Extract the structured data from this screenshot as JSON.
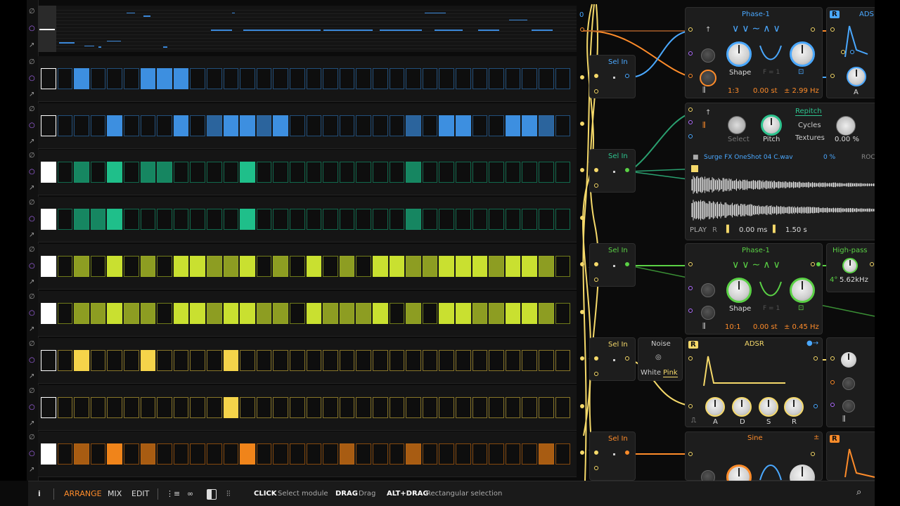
{
  "piano_roll": {
    "value": "0"
  },
  "grid": {
    "rows": [
      {
        "color": "#3d8fe0",
        "cells": [
          3,
          0,
          2,
          0,
          0,
          0,
          2,
          3,
          2,
          0,
          0,
          0,
          0,
          0,
          0,
          0,
          0,
          0,
          0,
          0,
          0,
          0,
          0,
          0,
          0,
          0,
          0,
          0,
          0,
          0,
          0,
          0
        ]
      },
      {
        "color": "#3d8fe0",
        "cells": [
          3,
          0,
          0,
          0,
          2,
          0,
          0,
          0,
          2,
          0,
          1,
          2,
          2,
          1,
          2,
          0,
          0,
          0,
          0,
          0,
          0,
          0,
          1,
          0,
          2,
          2,
          0,
          0,
          2,
          2,
          1,
          0
        ]
      },
      {
        "color": "#1fbf8a",
        "cells": [
          3,
          0,
          1,
          0,
          2,
          0,
          1,
          1,
          0,
          0,
          0,
          0,
          2,
          0,
          0,
          0,
          0,
          0,
          0,
          0,
          0,
          0,
          1,
          0,
          0,
          0,
          0,
          0,
          0,
          0,
          0,
          0
        ]
      },
      {
        "color": "#1fbf8a",
        "cells": [
          3,
          0,
          1,
          1,
          2,
          0,
          0,
          0,
          0,
          0,
          0,
          0,
          2,
          0,
          0,
          0,
          0,
          0,
          0,
          0,
          0,
          0,
          1,
          0,
          0,
          0,
          0,
          0,
          0,
          0,
          0,
          0
        ]
      },
      {
        "color": "#c9e030",
        "cells": [
          3,
          0,
          1,
          0,
          2,
          0,
          1,
          0,
          2,
          2,
          1,
          1,
          2,
          0,
          1,
          0,
          2,
          0,
          1,
          0,
          2,
          2,
          1,
          1,
          2,
          2,
          2,
          1,
          2,
          2,
          1,
          0
        ]
      },
      {
        "color": "#c9e030",
        "cells": [
          3,
          0,
          1,
          1,
          2,
          1,
          1,
          0,
          2,
          2,
          1,
          2,
          2,
          1,
          1,
          0,
          2,
          1,
          1,
          1,
          2,
          0,
          1,
          0,
          2,
          2,
          1,
          1,
          2,
          2,
          1,
          0
        ]
      },
      {
        "color": "#f5d44a",
        "cells": [
          3,
          0,
          2,
          0,
          0,
          0,
          2,
          0,
          0,
          0,
          0,
          2,
          0,
          0,
          0,
          0,
          0,
          0,
          0,
          0,
          0,
          0,
          0,
          0,
          0,
          0,
          0,
          0,
          0,
          0,
          0,
          0
        ]
      },
      {
        "color": "#f5d44a",
        "cells": [
          3,
          0,
          0,
          0,
          0,
          0,
          0,
          0,
          0,
          0,
          0,
          2,
          0,
          0,
          0,
          0,
          0,
          0,
          0,
          0,
          0,
          0,
          0,
          0,
          0,
          0,
          0,
          0,
          0,
          0,
          0,
          0
        ]
      },
      {
        "color": "#f0841a",
        "cells": [
          3,
          0,
          1,
          0,
          2,
          0,
          1,
          0,
          0,
          0,
          0,
          0,
          2,
          0,
          0,
          0,
          0,
          0,
          1,
          0,
          0,
          0,
          1,
          0,
          0,
          0,
          0,
          0,
          0,
          0,
          1,
          0
        ]
      }
    ]
  },
  "selin": {
    "label": "Sel In"
  },
  "phase1_top": {
    "title": "Phase-1",
    "shape_label": "Shape",
    "f_label": "F = 1",
    "ratio": "1:3",
    "st": "0.00 st",
    "hz": "± 2.99 Hz"
  },
  "adsr_top": {
    "badge": "R",
    "title": "ADS",
    "a_label": "A"
  },
  "sampler": {
    "repitch": "Repitch",
    "cycles": "Cycles",
    "textures": "Textures",
    "select": "Select",
    "pitch": "Pitch",
    "percent": "0.00 %",
    "file": "Surge FX OneShot 04 C.wav",
    "zero_percent": "0 %",
    "roo": "ROC",
    "play": "PLAY",
    "r_mark": "R",
    "start": "0.00 ms",
    "length": "1.50 s"
  },
  "phase1_mid": {
    "title": "Phase-1",
    "shape_label": "Shape",
    "f_label": "F = 1",
    "ratio": "10:1",
    "st": "0.00 st",
    "hz": "± 0.45 Hz"
  },
  "highpass": {
    "title": "High-pass",
    "deg": "4°",
    "freq": "5.62kHz"
  },
  "noise": {
    "title": "Noise",
    "white": "White",
    "pink": "Pink"
  },
  "adsr_mid": {
    "badge": "R",
    "title": "ADSR",
    "a": "A",
    "d": "D",
    "s": "S",
    "r": "R"
  },
  "sine": {
    "title": "Sine",
    "plus": "±"
  },
  "adsr_bot": {
    "badge": "R"
  },
  "bottom_bar": {
    "info": "i",
    "arrange": "ARRANGE",
    "mix": "MIX",
    "edit": "EDIT",
    "click_key": "CLICK",
    "click_desc": "Select module",
    "drag_key": "DRAG",
    "drag_desc": "Drag",
    "altdrag_key": "ALT+DRAG",
    "altdrag_desc": "Rectangular selection"
  },
  "colors": {
    "accent_orange": "#ff8c2a",
    "cable_yellow": "#f5d96a",
    "cable_green": "#5ad145",
    "cable_blue": "#4aa8ff",
    "module_title_blue": "#4aa8ff",
    "module_title_green": "#5ad145"
  },
  "icons": [
    "phase-icon",
    "circle-dot-icon",
    "arrow-out-icon",
    "gate-icon",
    "folder-icon",
    "search-icon",
    "flag-icon",
    "link-icon",
    "mixer-icon",
    "panel-icon",
    "sliders-icon",
    "chain-icon"
  ]
}
